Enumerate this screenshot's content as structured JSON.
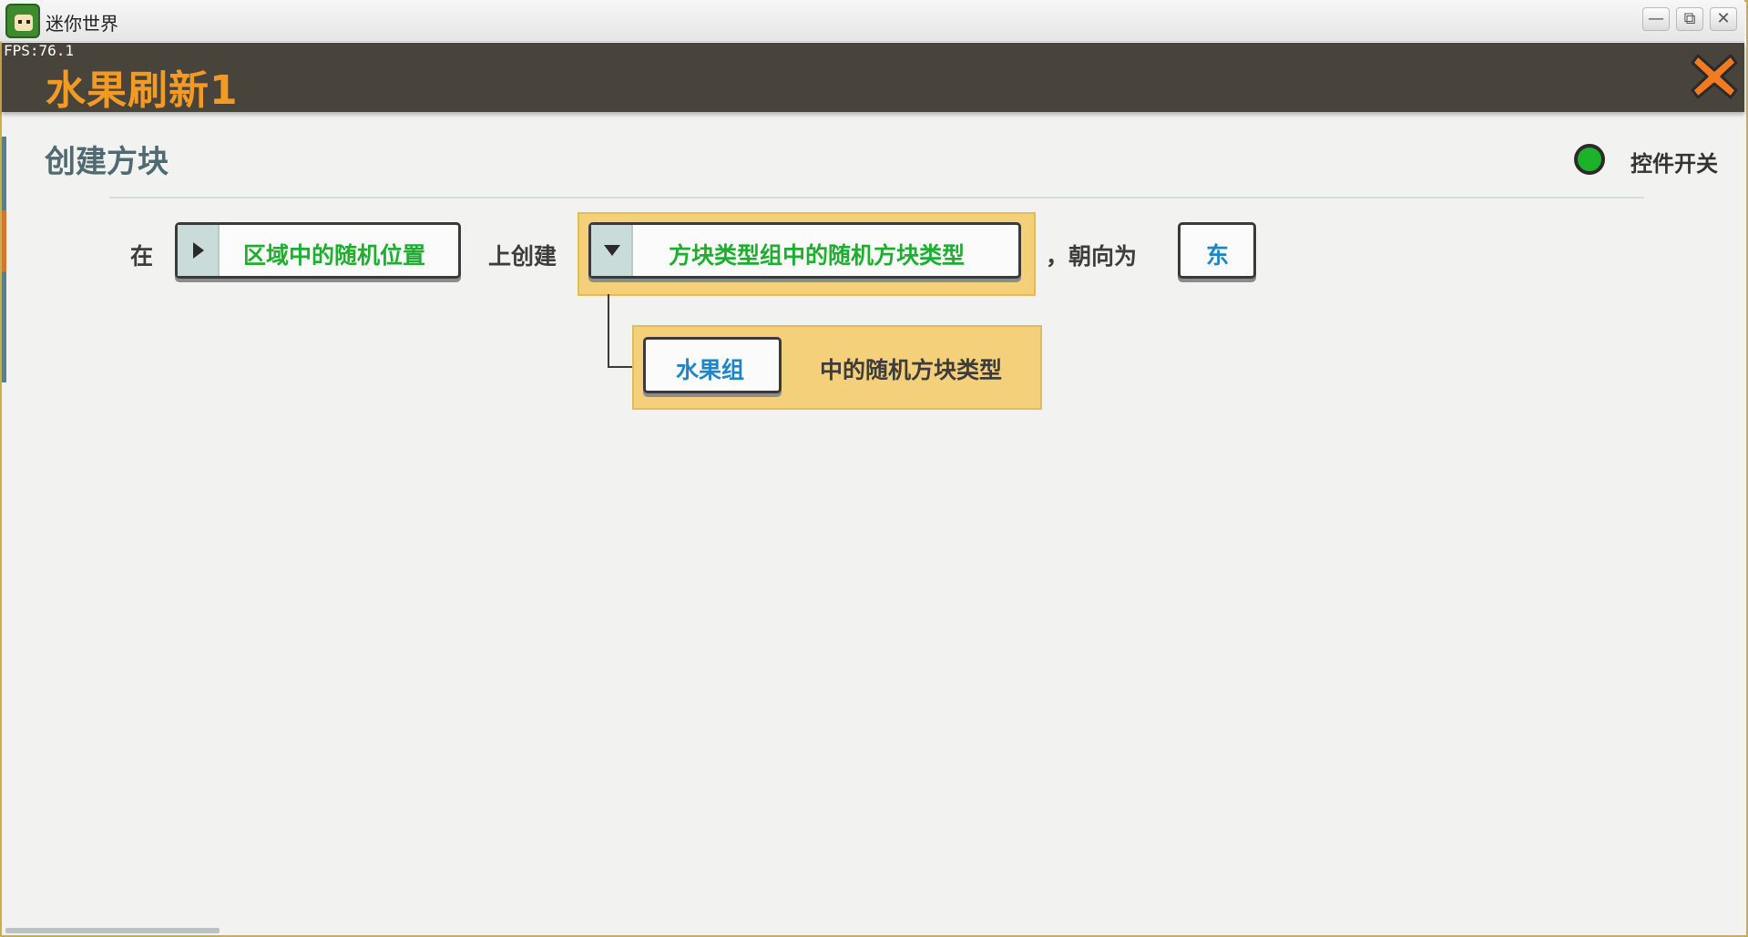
{
  "window": {
    "title": "迷你世界",
    "minimize_label": "—",
    "maximize_label": "⧉",
    "close_label": "✕"
  },
  "fps": "FPS:76.1",
  "header": {
    "title": "水果刷新1",
    "close_icon": "close-x-icon",
    "accent_color": "#f39a25"
  },
  "section": {
    "title": "创建方块",
    "toggle_label": "控件开关",
    "toggle_state": "on",
    "toggle_color": "#1cb32a"
  },
  "statement": {
    "word_at": "在",
    "position_slot": "区域中的随机位置",
    "word_create": "上创建",
    "block_slot": "方块类型组中的随机方块类型",
    "word_facing": "，朝向为",
    "direction_slot": "东",
    "sub_slot": "水果组",
    "sub_suffix": "中的随机方块类型"
  }
}
